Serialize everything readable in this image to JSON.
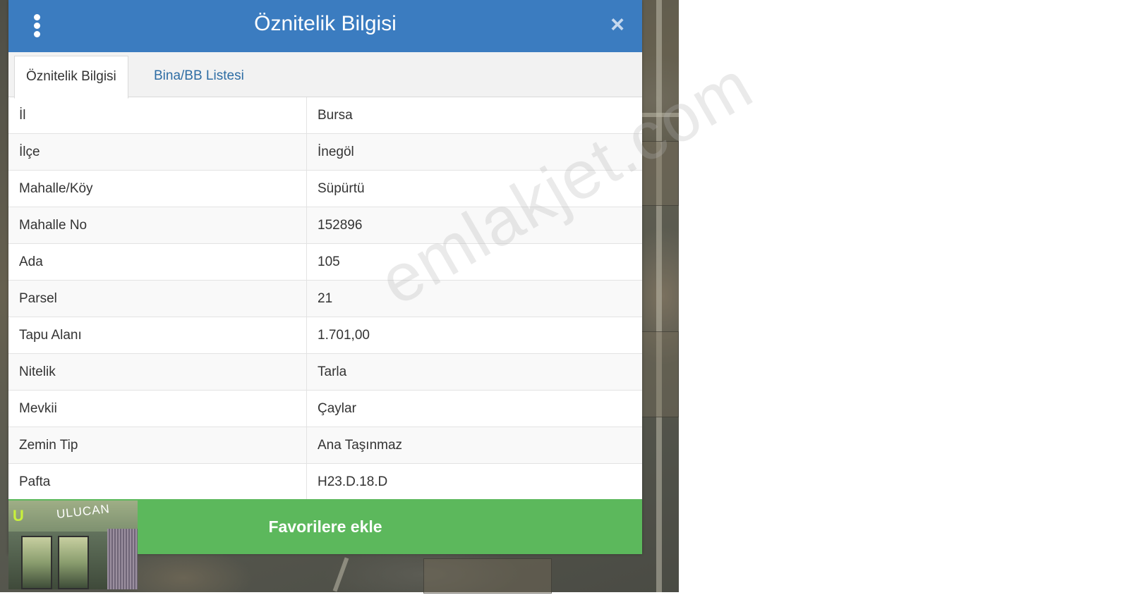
{
  "dialog": {
    "title": "Öznitelik Bilgisi",
    "close_symbol": "×",
    "menu_icon": "vertical-dots-icon"
  },
  "tabs": [
    {
      "label": "Öznitelik Bilgisi",
      "active": true
    },
    {
      "label": "Bina/BB Listesi",
      "active": false
    }
  ],
  "attributes": [
    {
      "key": "İl",
      "value": "Bursa"
    },
    {
      "key": "İlçe",
      "value": "İnegöl"
    },
    {
      "key": "Mahalle/Köy",
      "value": "Süpürtü"
    },
    {
      "key": "Mahalle No",
      "value": "152896"
    },
    {
      "key": "Ada",
      "value": "105"
    },
    {
      "key": "Parsel",
      "value": "21"
    },
    {
      "key": "Tapu Alanı",
      "value": "1.701,00"
    },
    {
      "key": "Nitelik",
      "value": "Tarla"
    },
    {
      "key": "Mevkii",
      "value": "Çaylar"
    },
    {
      "key": "Zemin Tip",
      "value": "Ana Taşınmaz"
    },
    {
      "key": "Pafta",
      "value": "H23.D.18.D"
    }
  ],
  "actions": {
    "favorite_label": "Favorilere ekle"
  },
  "store_image": {
    "logo_letter": "U",
    "name": "ULUCAN"
  },
  "watermark": "emlakjet.com",
  "colors": {
    "header": "#3b7cc0",
    "favorite_button": "#5cb85c",
    "tab_link": "#2e6da4"
  }
}
